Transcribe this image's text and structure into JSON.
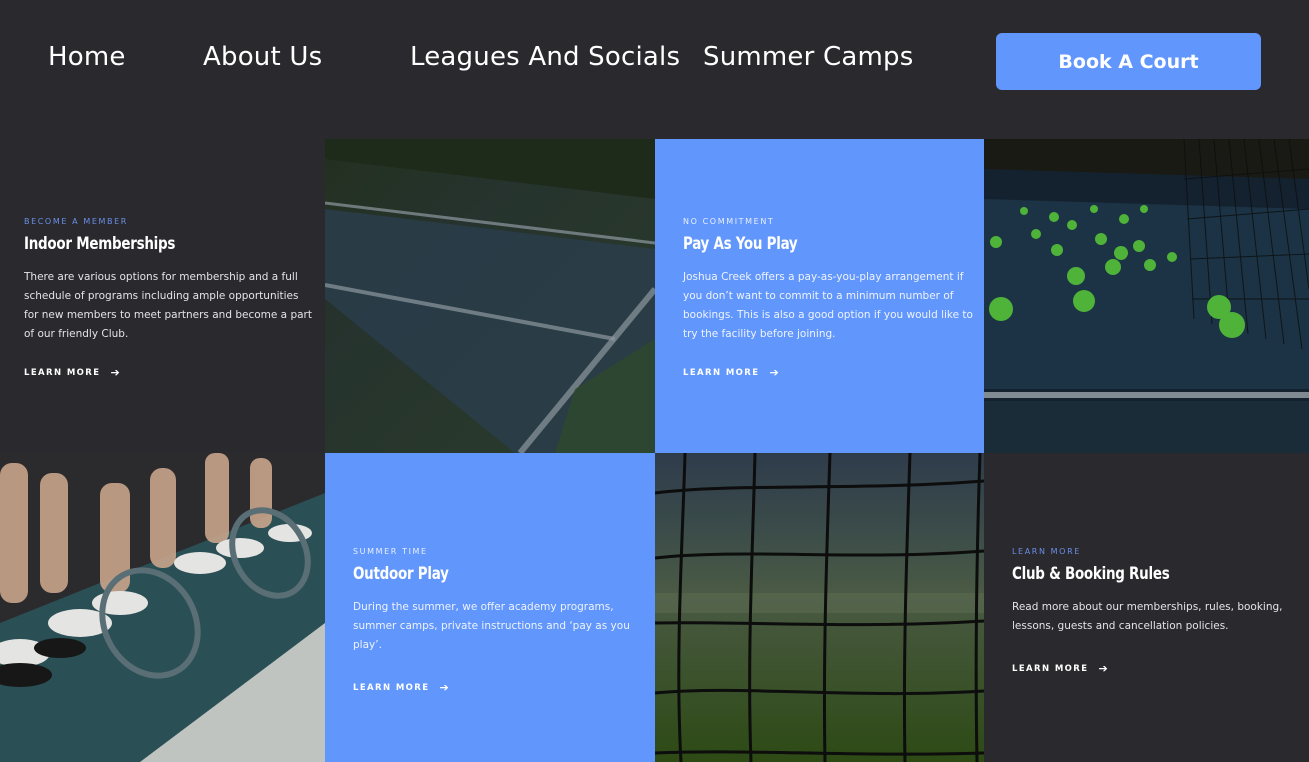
{
  "nav": {
    "items": [
      "Home",
      "About Us",
      "Leagues And Socials",
      "Summer Camps"
    ],
    "cta": "Book A Court"
  },
  "tiles": {
    "indoor": {
      "eyebrow": "BECOME A MEMBER",
      "title": "Indoor Memberships",
      "body": "There are various options for membership and a full schedule of programs including ample opportunities for new members to meet partners and become a part of our friendly Club.",
      "link": "LEARN MORE"
    },
    "payg": {
      "eyebrow": "NO COMMITMENT",
      "title": "Pay As You Play",
      "body": "Joshua Creek offers a pay-as-you-play arrangement if you don’t want to commit to a minimum number of bookings. This is also a good option if you would like to try the facility before joining.",
      "link": "LEARN MORE"
    },
    "outdoor": {
      "eyebrow": "SUMMER TIME",
      "title": "Outdoor Play",
      "body": "During the summer, we offer academy programs, summer camps, private instructions and ‘pay as you play’.",
      "link": "LEARN MORE"
    },
    "rules": {
      "eyebrow": "LEARN MORE",
      "title": "Club & Booking Rules",
      "body": "Read more about our memberships, rules, booking, lessons, guests and cancellation policies.",
      "link": "LEARN MORE"
    }
  },
  "icons": {
    "link_arrow": "arrow-right-icon"
  },
  "colors": {
    "accent": "#6196fc",
    "dark": "#2a292e"
  }
}
